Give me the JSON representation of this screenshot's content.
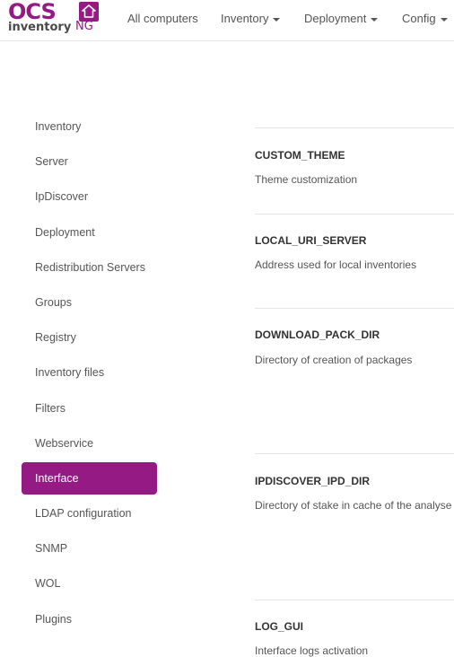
{
  "brand": {
    "logo_top": "OCS",
    "logo_bottom": "inventory",
    "logo_suffix": "NG",
    "accent_color": "#951a84"
  },
  "navbar": {
    "items": [
      {
        "label": "All computers",
        "has_caret": false
      },
      {
        "label": "Inventory",
        "has_caret": true
      },
      {
        "label": "Deployment",
        "has_caret": true
      },
      {
        "label": "Config",
        "has_caret": true
      }
    ]
  },
  "sidebar": {
    "items": [
      {
        "label": "Inventory"
      },
      {
        "label": "Server"
      },
      {
        "label": "IpDiscover"
      },
      {
        "label": "Deployment"
      },
      {
        "label": "Redistribution Servers"
      },
      {
        "label": "Groups"
      },
      {
        "label": "Registry"
      },
      {
        "label": "Inventory files"
      },
      {
        "label": "Filters"
      },
      {
        "label": "Webservice"
      },
      {
        "label": "Interface"
      },
      {
        "label": "LDAP configuration"
      },
      {
        "label": "SNMP"
      },
      {
        "label": "WOL"
      },
      {
        "label": "Plugins"
      }
    ],
    "active": "Interface"
  },
  "settings": [
    {
      "name": "CUSTOM_THEME",
      "description": "Theme customization"
    },
    {
      "name": "LOCAL_URI_SERVER",
      "description": "Address used for local inventories"
    },
    {
      "name": "DOWNLOAD_PACK_DIR",
      "description": "Directory of creation of packages"
    },
    {
      "name": "IPDISCOVER_IPD_DIR",
      "description": "Directory of stake in cache of the analyse"
    },
    {
      "name": "LOG_GUI",
      "description": "Interface logs activation"
    }
  ]
}
